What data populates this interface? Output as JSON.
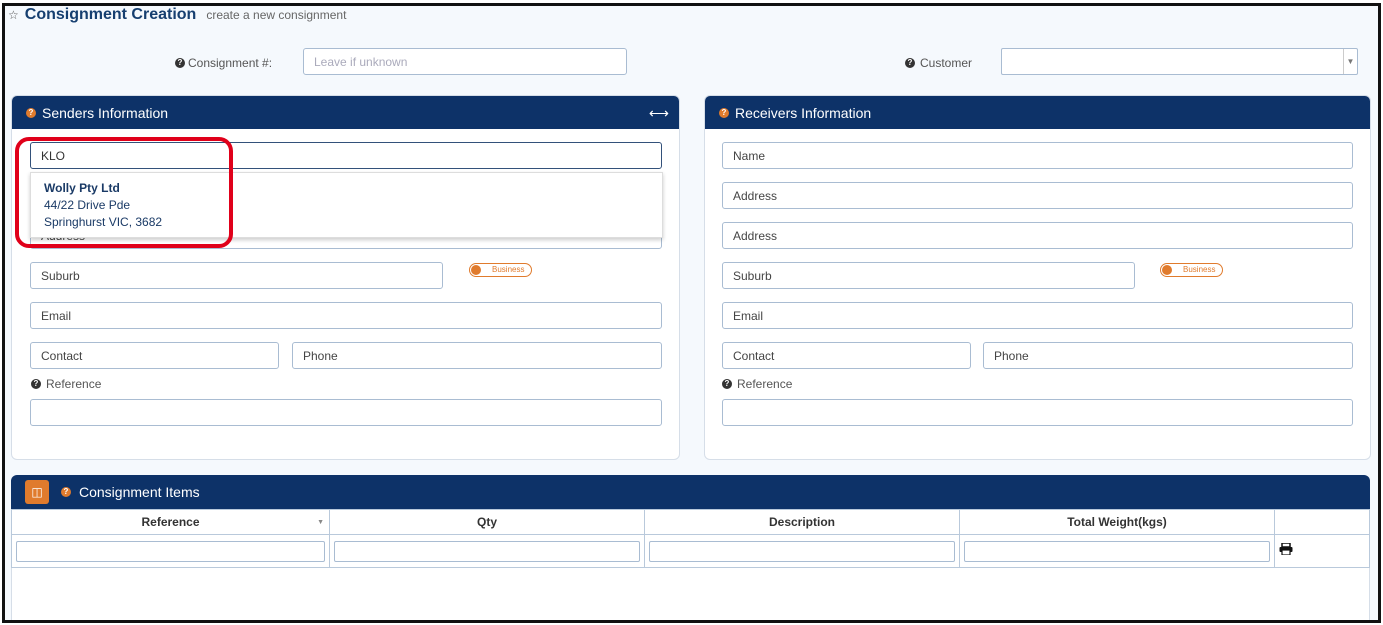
{
  "header": {
    "title": "Consignment Creation",
    "subtitle": "create a new consignment"
  },
  "consignment": {
    "label": "Consignment #:",
    "placeholder": "Leave if unknown",
    "value": ""
  },
  "customer": {
    "label": "Customer",
    "value": ""
  },
  "senders": {
    "title": "Senders Information",
    "name_value": "KLO",
    "address2_placeholder": "Address",
    "suburb_placeholder": "Suburb",
    "business_label": "Business",
    "email_placeholder": "Email",
    "contact_placeholder": "Contact",
    "phone_placeholder": "Phone",
    "reference_label": "Reference",
    "suggestion": {
      "name": "Wolly Pty Ltd",
      "line1": "44/22 Drive Pde",
      "line2": "Springhurst VIC, 3682"
    }
  },
  "receivers": {
    "title": "Receivers Information",
    "name_placeholder": "Name",
    "address1_placeholder": "Address",
    "address2_placeholder": "Address",
    "suburb_placeholder": "Suburb",
    "business_label": "Business",
    "email_placeholder": "Email",
    "contact_placeholder": "Contact",
    "phone_placeholder": "Phone",
    "reference_label": "Reference"
  },
  "items": {
    "title": "Consignment Items",
    "columns": [
      "Reference",
      "Qty",
      "Description",
      "Total Weight(kgs)",
      ""
    ]
  },
  "colors": {
    "header_navy": "#0d3268",
    "accent_orange": "#e07b2d",
    "highlight_red": "#e0001a"
  }
}
